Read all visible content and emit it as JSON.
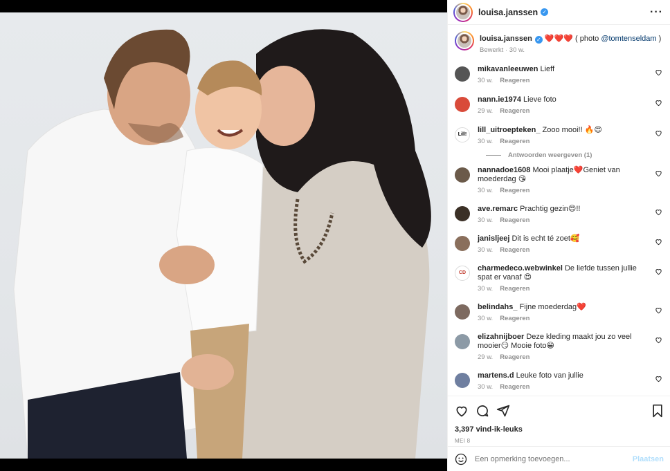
{
  "header": {
    "username": "louisa.janssen",
    "more_icon": "more-horizontal-icon"
  },
  "caption": {
    "username": "louisa.janssen",
    "text": " ❤️❤️❤️ ( photo ",
    "mention": "@tomtenseldam",
    "text_end": " )",
    "edited": "Bewerkt",
    "sep": " · ",
    "time": "30 w."
  },
  "comments": [
    {
      "user": "mikavanleeuwen",
      "text": "Lieff",
      "time": "30 w.",
      "reply": "Reageren",
      "avatar_color": "#555555"
    },
    {
      "user": "nann.ie1974",
      "text": "Lieve foto",
      "time": "29 w.",
      "reply": "Reageren",
      "avatar_color": "#d94b3a"
    },
    {
      "user": "lill_uitroepteken_",
      "text": "Zooo mooi!! 🔥😍",
      "time": "30 w.",
      "reply": "Reageren",
      "avatar_color": "#ffffff",
      "avatar_text": "Lill!"
    },
    {
      "user": "nannadoe1608",
      "text": "Mooi plaatje❤️Geniet van moederdag 😘",
      "time": "30 w.",
      "reply": "Reageren",
      "avatar_color": "#6b5a4a"
    },
    {
      "user": "ave.remarc",
      "text": "Prachtig gezin😍!!",
      "time": "30 w.",
      "reply": "Reageren",
      "avatar_color": "#3b3026"
    },
    {
      "user": "janisljeej",
      "text": "Dit is echt té zoet🥰",
      "time": "30 w.",
      "reply": "Reageren",
      "avatar_color": "#8a6f5c"
    },
    {
      "user": "charmedeco.webwinkel",
      "text": "De liefde tussen jullie spat er vanaf 😍",
      "time": "30 w.",
      "reply": "Reageren",
      "avatar_color": "#ffffff",
      "avatar_text": "CD"
    },
    {
      "user": "belindahs_",
      "text": "Fijne moederdag❤️",
      "time": "30 w.",
      "reply": "Reageren",
      "avatar_color": "#7d6a60"
    },
    {
      "user": "elizahnijboer",
      "text": "Deze kleding maakt jou zo veel mooier😏 Mooie foto😁",
      "time": "29 w.",
      "reply": "Reageren",
      "avatar_color": "#8c9aa6"
    },
    {
      "user": "martens.d",
      "text": "Leuke foto van jullie",
      "time": "30 w.",
      "reply": "Reageren",
      "avatar_color": "#6f7fa0"
    }
  ],
  "view_replies": "Antwoorden weergeven (1)",
  "actions": {
    "likes": "3,397 vind-ik-leuks",
    "date": "MEI 8"
  },
  "add_comment": {
    "placeholder": "Een opmerking toevoegen...",
    "post": "Plaatsen"
  }
}
